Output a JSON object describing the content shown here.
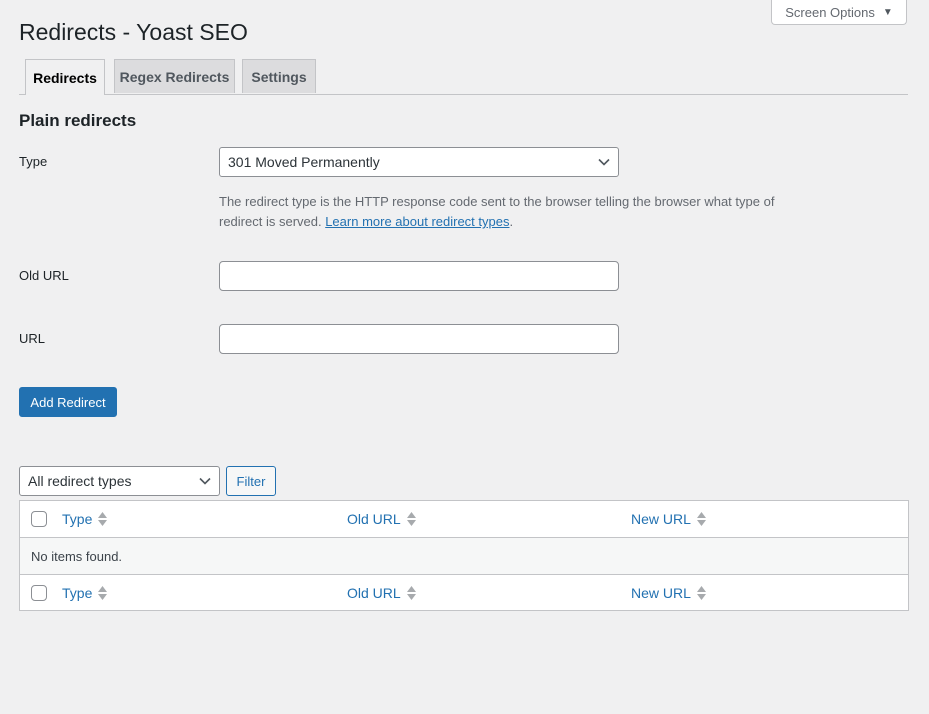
{
  "header": {
    "screen_options_label": "Screen Options",
    "page_title": "Redirects - Yoast SEO"
  },
  "tabs": [
    {
      "label": "Redirects",
      "active": true
    },
    {
      "label": "Regex Redirects",
      "active": false
    },
    {
      "label": "Settings",
      "active": false
    }
  ],
  "form": {
    "section_title": "Plain redirects",
    "type_label": "Type",
    "type_value": "301 Moved Permanently",
    "description_text": "The redirect type is the HTTP response code sent to the browser telling the browser what type of redirect is served. ",
    "description_link": "Learn more about redirect types",
    "description_end": ".",
    "old_url_label": "Old URL",
    "old_url_value": "",
    "url_label": "URL",
    "url_value": "",
    "add_button_label": "Add Redirect"
  },
  "filter": {
    "select_value": "All redirect types",
    "button_label": "Filter"
  },
  "table": {
    "columns": [
      "Type",
      "Old URL",
      "New URL"
    ],
    "empty_message": "No items found."
  },
  "colors": {
    "primary": "#2271b1",
    "background": "#f0f0f1"
  }
}
